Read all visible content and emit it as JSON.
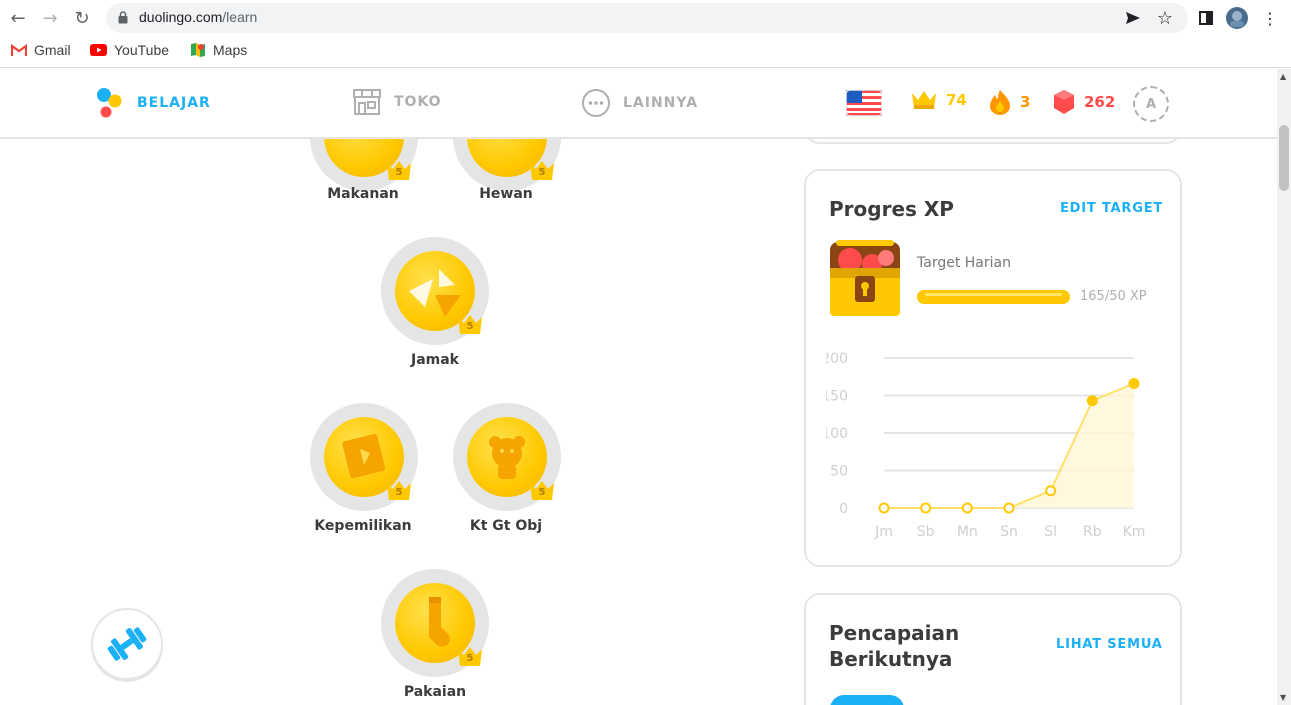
{
  "browser": {
    "url_host": "duolingo.com",
    "url_path": "/learn",
    "bookmarks": [
      {
        "label": "Gmail",
        "icon": "gmail-icon"
      },
      {
        "label": "YouTube",
        "icon": "youtube-icon"
      },
      {
        "label": "Maps",
        "icon": "maps-icon"
      }
    ]
  },
  "nav": {
    "learn": "BELAJAR",
    "shop": "TOKO",
    "more": "LAINNYA",
    "crowns": "74",
    "streak": "3",
    "gems": "262",
    "avatar_letter": "A"
  },
  "colors": {
    "active_blue": "#1cb0f6",
    "inactive_gray": "#afafaf",
    "gold": "#ffc800",
    "streak_orange": "#ff9600",
    "gem_red": "#ff4b4b"
  },
  "skills": [
    {
      "name": "Makanan",
      "level": "5"
    },
    {
      "name": "Hewan",
      "level": "5"
    },
    {
      "name": "Jamak",
      "level": "5"
    },
    {
      "name": "Kepemilikan",
      "level": "5"
    },
    {
      "name": "Kt Gt Obj",
      "level": "5"
    },
    {
      "name": "Pakaian",
      "level": "5"
    }
  ],
  "xp_card": {
    "title": "Progres XP",
    "edit_link": "EDIT TARGET",
    "daily_goal_label": "Target Harian",
    "progress_text": "165/50 XP",
    "progress_fraction": 1.0
  },
  "chart_data": {
    "type": "area",
    "categories": [
      "Jm",
      "Sb",
      "Mn",
      "Sn",
      "Sl",
      "Rb",
      "Km"
    ],
    "values": [
      0,
      0,
      0,
      0,
      23,
      143,
      166
    ],
    "ylim": [
      0,
      200
    ],
    "yticks": [
      "0",
      "50",
      "100",
      "150",
      "200"
    ],
    "grid": true,
    "color": "#ffc800"
  },
  "achievements_card": {
    "title_line1": "Pencapaian",
    "title_line2": "Berikutnya",
    "see_all_link": "LIHAT SEMUA"
  }
}
